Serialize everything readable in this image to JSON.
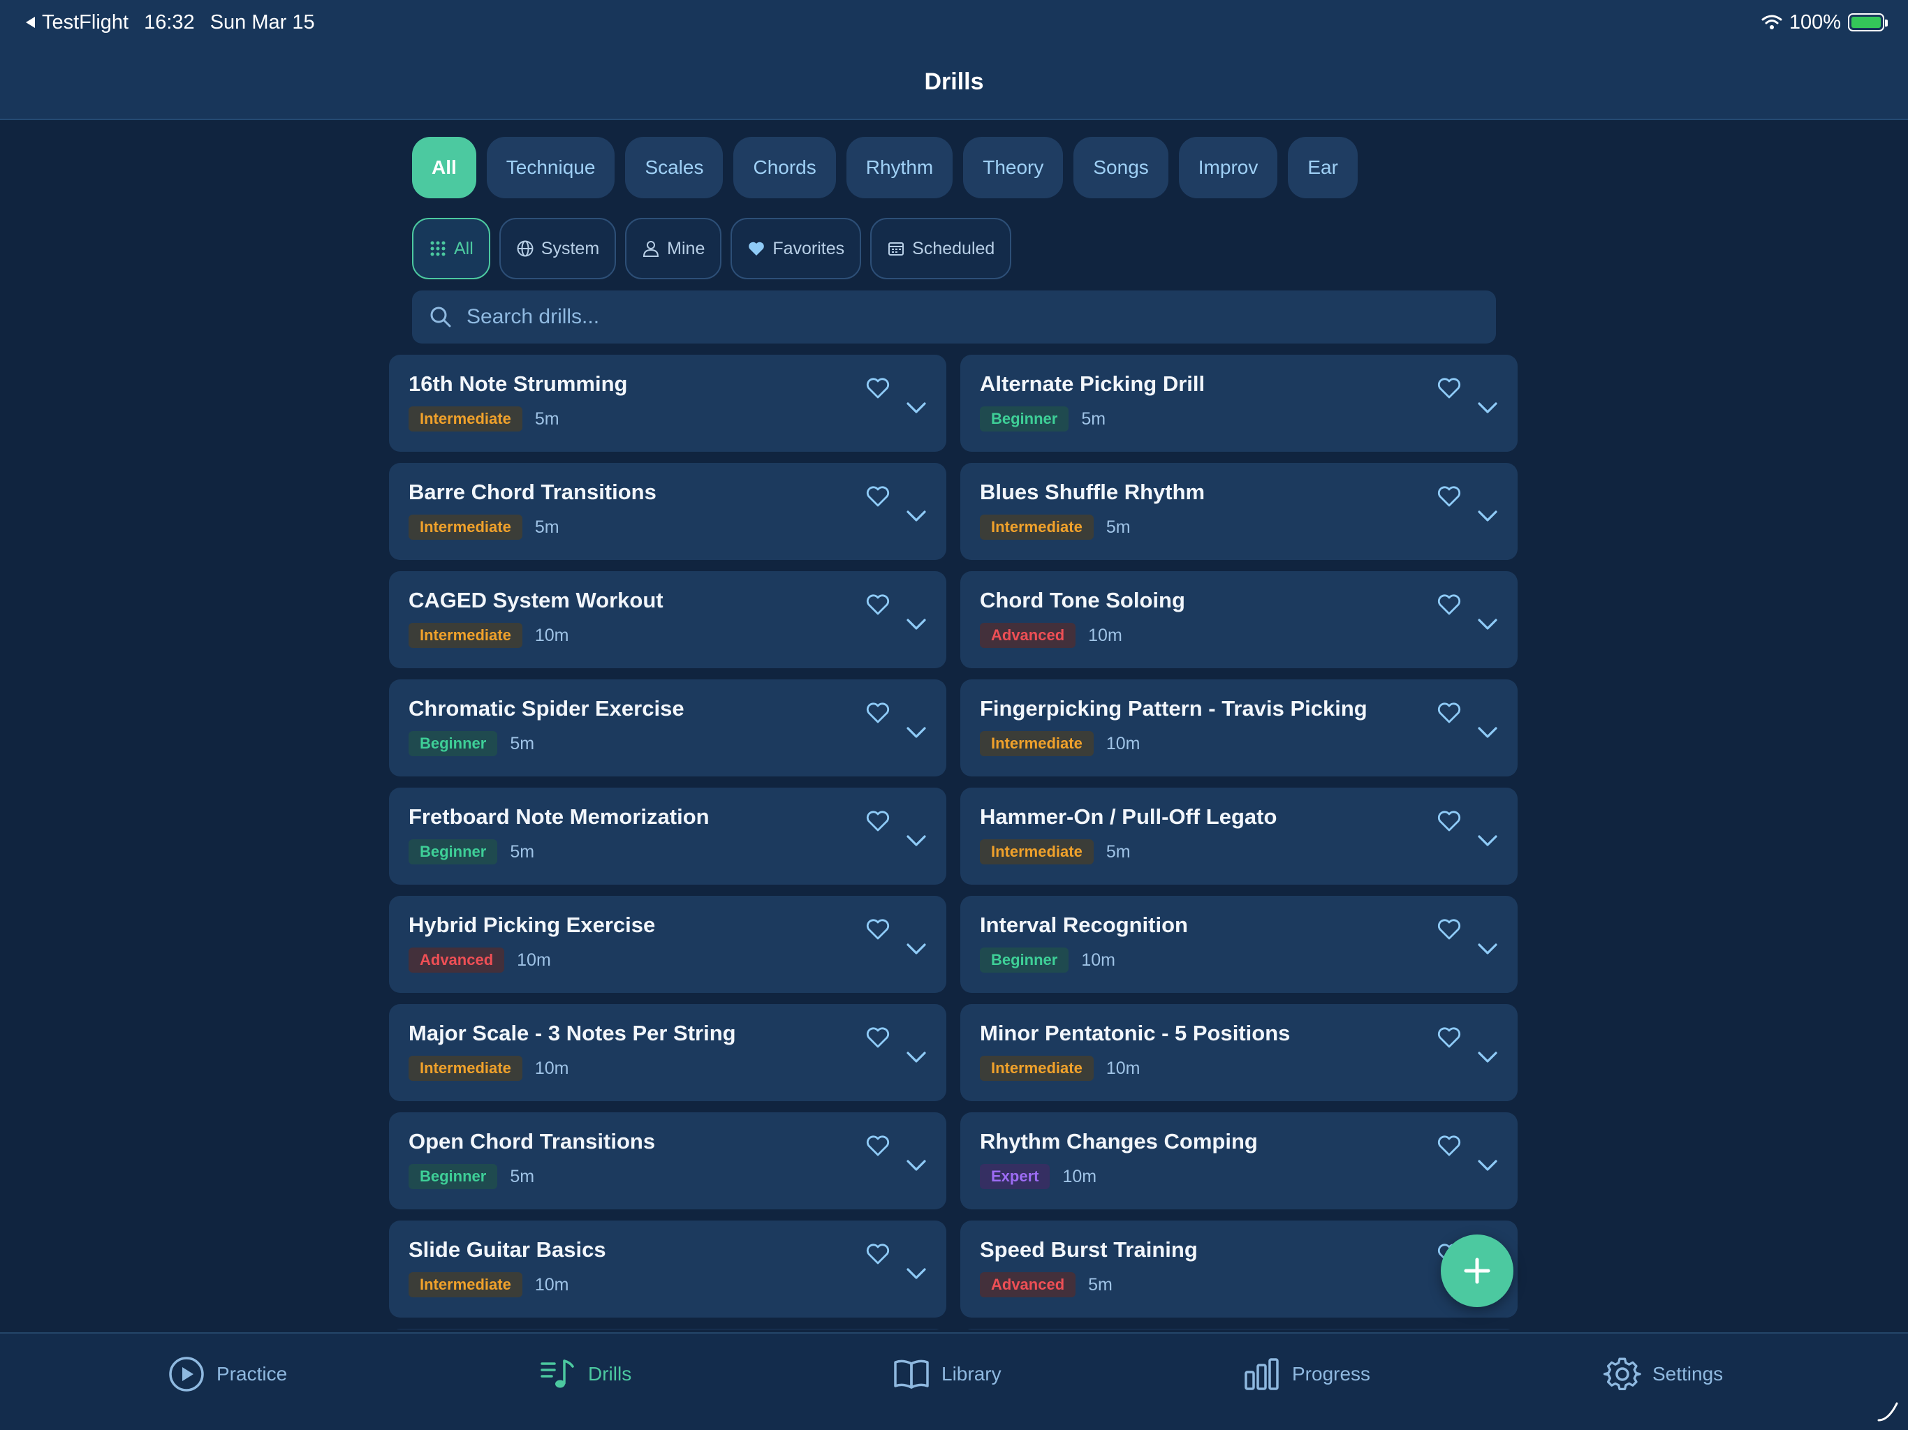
{
  "status_bar": {
    "back_app": "TestFlight",
    "time": "16:32",
    "date": "Sun Mar 15",
    "battery": "100%"
  },
  "header": {
    "title": "Drills"
  },
  "categories": [
    "All",
    "Technique",
    "Scales",
    "Chords",
    "Rhythm",
    "Theory",
    "Songs",
    "Improv",
    "Ear"
  ],
  "active_category": "All",
  "sources": [
    {
      "label": "All",
      "icon": "grid-icon",
      "active": true
    },
    {
      "label": "System",
      "icon": "globe-icon",
      "active": false
    },
    {
      "label": "Mine",
      "icon": "person-icon",
      "active": false
    },
    {
      "label": "Favorites",
      "icon": "heart-filled-icon",
      "active": false
    },
    {
      "label": "Scheduled",
      "icon": "calendar-icon",
      "active": false
    }
  ],
  "search": {
    "placeholder": "Search drills..."
  },
  "drills": [
    {
      "title": "16th Note Strumming",
      "level": "Intermediate",
      "duration": "5m"
    },
    {
      "title": "Alternate Picking Drill",
      "level": "Beginner",
      "duration": "5m"
    },
    {
      "title": "Barre Chord Transitions",
      "level": "Intermediate",
      "duration": "5m"
    },
    {
      "title": "Blues Shuffle Rhythm",
      "level": "Intermediate",
      "duration": "5m"
    },
    {
      "title": "CAGED System Workout",
      "level": "Intermediate",
      "duration": "10m"
    },
    {
      "title": "Chord Tone Soloing",
      "level": "Advanced",
      "duration": "10m"
    },
    {
      "title": "Chromatic Spider Exercise",
      "level": "Beginner",
      "duration": "5m"
    },
    {
      "title": "Fingerpicking Pattern - Travis Picking",
      "level": "Intermediate",
      "duration": "10m"
    },
    {
      "title": "Fretboard Note Memorization",
      "level": "Beginner",
      "duration": "5m"
    },
    {
      "title": "Hammer-On / Pull-Off Legato",
      "level": "Intermediate",
      "duration": "5m"
    },
    {
      "title": "Hybrid Picking Exercise",
      "level": "Advanced",
      "duration": "10m"
    },
    {
      "title": "Interval Recognition",
      "level": "Beginner",
      "duration": "10m"
    },
    {
      "title": "Major Scale - 3 Notes Per String",
      "level": "Intermediate",
      "duration": "10m"
    },
    {
      "title": "Minor Pentatonic - 5 Positions",
      "level": "Intermediate",
      "duration": "10m"
    },
    {
      "title": "Open Chord Transitions",
      "level": "Beginner",
      "duration": "5m"
    },
    {
      "title": "Rhythm Changes Comping",
      "level": "Expert",
      "duration": "10m"
    },
    {
      "title": "Slide Guitar Basics",
      "level": "Intermediate",
      "duration": "10m"
    },
    {
      "title": "Speed Burst Training",
      "level": "Advanced",
      "duration": "5m"
    }
  ],
  "tabs": [
    {
      "label": "Practice",
      "icon": "play-circle-icon",
      "active": false
    },
    {
      "label": "Drills",
      "icon": "music-list-icon",
      "active": true
    },
    {
      "label": "Library",
      "icon": "book-icon",
      "active": false
    },
    {
      "label": "Progress",
      "icon": "bar-chart-icon",
      "active": false
    },
    {
      "label": "Settings",
      "icon": "gear-icon",
      "active": false
    }
  ],
  "colors": {
    "accent": "#4cc9a0",
    "background": "#10243f",
    "card": "#1c3a5e",
    "beginner": "#3ecf97",
    "intermediate": "#f0a12b",
    "advanced": "#ee4f55",
    "expert": "#9d6cf4"
  }
}
